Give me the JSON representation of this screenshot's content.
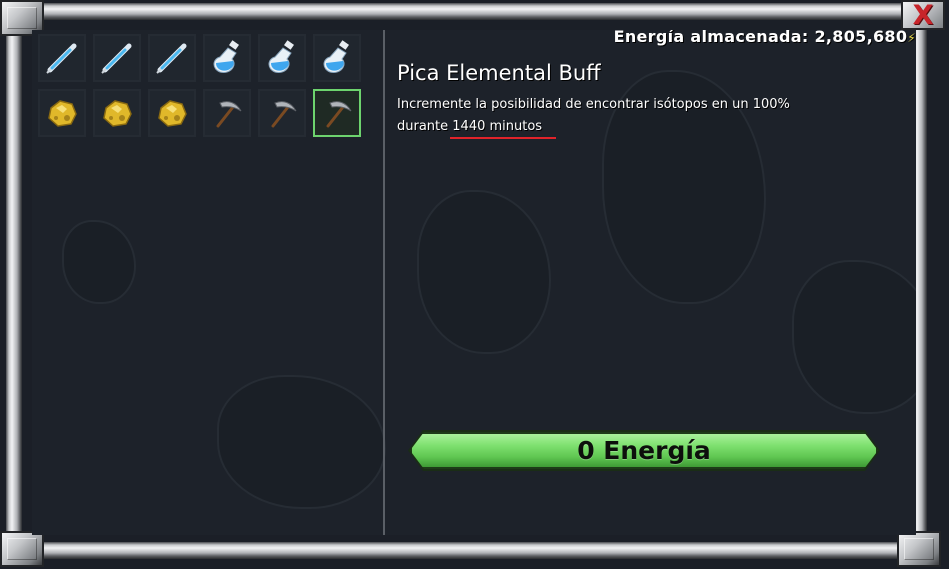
{
  "header": {
    "energy_label": "Energía almacenada: 2,805,680",
    "energy_symbol": "⚡"
  },
  "inventory": {
    "items": [
      {
        "icon": "syringe-icon",
        "color": "#4ab8f0"
      },
      {
        "icon": "syringe-icon",
        "color": "#4ab8f0"
      },
      {
        "icon": "syringe-icon",
        "color": "#4ab8f0"
      },
      {
        "icon": "potion-bottle-icon",
        "color": "#3fa6ee"
      },
      {
        "icon": "potion-bottle-icon",
        "color": "#3fa6ee"
      },
      {
        "icon": "potion-bottle-icon",
        "color": "#3fa6ee"
      },
      {
        "icon": "gold-ore-icon",
        "color": "#e0b82a"
      },
      {
        "icon": "gold-ore-icon",
        "color": "#e0b82a"
      },
      {
        "icon": "gold-ore-icon",
        "color": "#e0b82a"
      },
      {
        "icon": "pickaxe-icon",
        "color": "#b0b4ba"
      },
      {
        "icon": "pickaxe-icon",
        "color": "#b0b4ba"
      },
      {
        "icon": "pickaxe-icon",
        "color": "#b0b4ba",
        "selected": true
      }
    ]
  },
  "details": {
    "title": "Pica Elemental Buff",
    "description_line1": "Incremente la posibilidad de encontrar isótopos en un 100%",
    "description_prefix": "durante ",
    "duration": "1440 minutos"
  },
  "action": {
    "button_label": "0 Energía"
  },
  "close": {
    "label": "X"
  },
  "colors": {
    "accent_green": "#6dd46e",
    "underline_red": "#e0232a",
    "close_red": "#c8242a"
  }
}
